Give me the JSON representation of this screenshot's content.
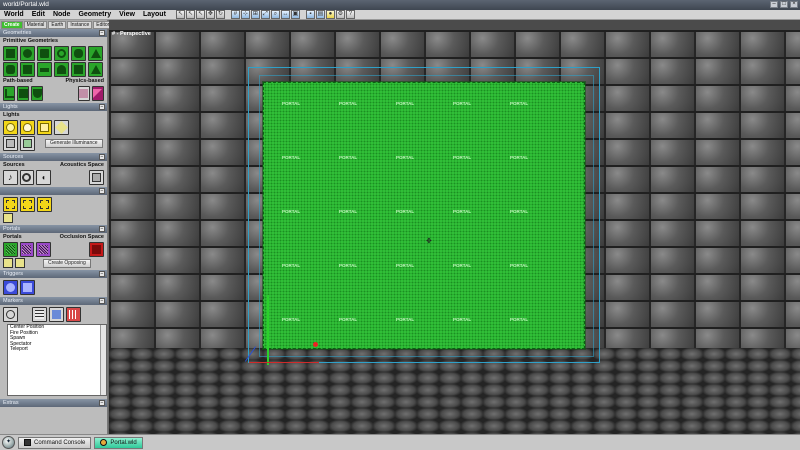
{
  "window": {
    "title": "world/Portal.wld"
  },
  "menu": [
    "World",
    "Edit",
    "Node",
    "Geometry",
    "View",
    "Layout"
  ],
  "sidebar": {
    "tabs": [
      "Create",
      "Material",
      "Earth",
      "Instance",
      "Editor"
    ],
    "geometries": {
      "header": "Geometries",
      "label": "Primitive Geometries",
      "path_label": "Path-based",
      "physics_label": "Physics-based"
    },
    "lights": {
      "header": "Lights",
      "label": "Lights",
      "generate_button": "Generate Illuminance"
    },
    "sources": {
      "header": "Sources",
      "label": "Sources",
      "acoustic_label": "Acoustics Space"
    },
    "portals": {
      "header": "Portals",
      "label": "Portals",
      "occlusion_label": "Occlusion Space",
      "create_button": "Create Opposing"
    },
    "triggers": {
      "header": "Triggers"
    },
    "markers": {
      "header": "Markers",
      "items": [
        "Center Position",
        "Fire Position",
        "Spawn",
        "Spectator",
        "Teleport"
      ]
    },
    "extra_header": "Extras"
  },
  "viewport": {
    "label": "# - Perspective",
    "portal_text": "PORTAL"
  },
  "taskbar": {
    "items": [
      "Command Console",
      "Portal.wld"
    ]
  },
  "colors": {
    "portal": "#34c83c",
    "active_tab": "#3fbf2f",
    "bbox": "#2fa0c8"
  }
}
